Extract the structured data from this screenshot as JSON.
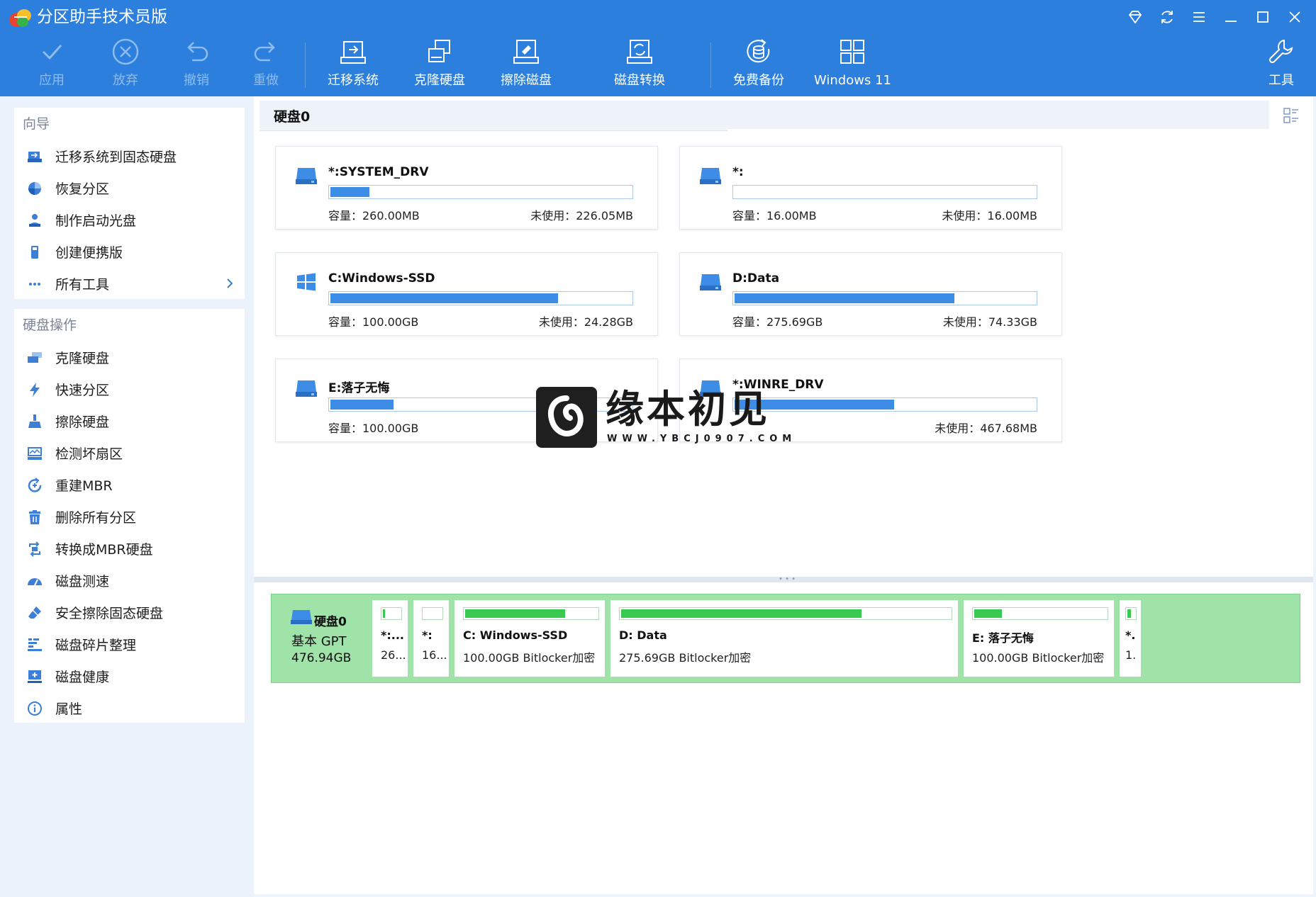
{
  "app": {
    "title": "分区助手技术员版"
  },
  "toolbar": {
    "apply": "应用",
    "discard": "放弃",
    "undo": "撤销",
    "redo": "重做",
    "migrate_os": "迁移系统",
    "clone_disk": "克隆硬盘",
    "wipe_disk": "擦除磁盘",
    "convert_disk": "磁盘转换",
    "free_backup": "免费备份",
    "windows11": "Windows 11",
    "tools": "工具"
  },
  "sidebar": {
    "wizard": {
      "heading": "向导",
      "items": [
        {
          "label": "迁移系统到固态硬盘",
          "icon": "migrate-ssd-icon"
        },
        {
          "label": "恢复分区",
          "icon": "recover-partition-icon"
        },
        {
          "label": "制作启动光盘",
          "icon": "bootable-media-icon"
        },
        {
          "label": "创建便携版",
          "icon": "portable-icon"
        },
        {
          "label": "所有工具",
          "icon": "more-icon"
        }
      ]
    },
    "disk_ops": {
      "heading": "硬盘操作",
      "items": [
        {
          "label": "克隆硬盘",
          "icon": "clone-disk-icon"
        },
        {
          "label": "快速分区",
          "icon": "lightning-icon"
        },
        {
          "label": "擦除硬盘",
          "icon": "wipe-icon"
        },
        {
          "label": "检测坏扇区",
          "icon": "bad-sector-icon"
        },
        {
          "label": "重建MBR",
          "icon": "rebuild-mbr-icon"
        },
        {
          "label": "删除所有分区",
          "icon": "trash-icon"
        },
        {
          "label": "转换成MBR硬盘",
          "icon": "convert-icon"
        },
        {
          "label": "磁盘测速",
          "icon": "speedometer-icon"
        },
        {
          "label": "安全擦除固态硬盘",
          "icon": "eraser-icon"
        },
        {
          "label": "磁盘碎片整理",
          "icon": "defrag-icon"
        },
        {
          "label": "磁盘健康",
          "icon": "health-icon"
        },
        {
          "label": "属性",
          "icon": "info-icon"
        }
      ]
    }
  },
  "main": {
    "disk_title": "硬盘0",
    "partitions": [
      {
        "name": "*:SYSTEM_DRV",
        "capacity": "容量：260.00MB",
        "free": "未使用：226.05MB",
        "used_fraction": 0.13,
        "icon": "drive-icon"
      },
      {
        "name": "*:",
        "capacity": "容量：16.00MB",
        "free": "未使用：16.00MB",
        "used_fraction": 0.0,
        "icon": "drive-icon"
      },
      {
        "name": "C:Windows-SSD",
        "capacity": "容量：100.00GB",
        "free": "未使用：24.28GB",
        "used_fraction": 0.757,
        "icon": "windows-icon"
      },
      {
        "name": "D:Data",
        "capacity": "容量：275.69GB",
        "free": "未使用：74.33GB",
        "used_fraction": 0.73,
        "icon": "drive-icon"
      },
      {
        "name": "E:落子无悔",
        "capacity": "容量：100.00GB",
        "free": "",
        "used_fraction": 0.21,
        "icon": "drive-icon"
      },
      {
        "name": "*:WINRE_DRV",
        "capacity": "",
        "free": "未使用：467.68MB",
        "used_fraction": 0.53,
        "icon": "drive-icon"
      }
    ],
    "disk_map": {
      "name": "硬盘0",
      "type": "基本 GPT",
      "size": "476.94GB",
      "parts": [
        {
          "label": "*:...",
          "sub": "26...",
          "used_fraction": 0.13
        },
        {
          "label": "*:",
          "sub": "16...",
          "used_fraction": 0.0
        },
        {
          "label": "C: Windows-SSD",
          "sub": "100.00GB Bitlocker加密",
          "used_fraction": 0.757
        },
        {
          "label": "D: Data",
          "sub": "275.69GB Bitlocker加密",
          "used_fraction": 0.73
        },
        {
          "label": "E: 落子无悔",
          "sub": "100.00GB Bitlocker加密",
          "used_fraction": 0.21
        },
        {
          "label": "*.",
          "sub": "1.",
          "used_fraction": 0.5
        }
      ]
    }
  },
  "watermark": {
    "title": "缘本初见",
    "url": "WWW.YBCJ0907.COM"
  },
  "colors": {
    "ribbon": "#2c7fdc",
    "bar_blue": "#3d8de6",
    "bar_green": "#38c950",
    "map_bg": "#9fe3a8"
  }
}
